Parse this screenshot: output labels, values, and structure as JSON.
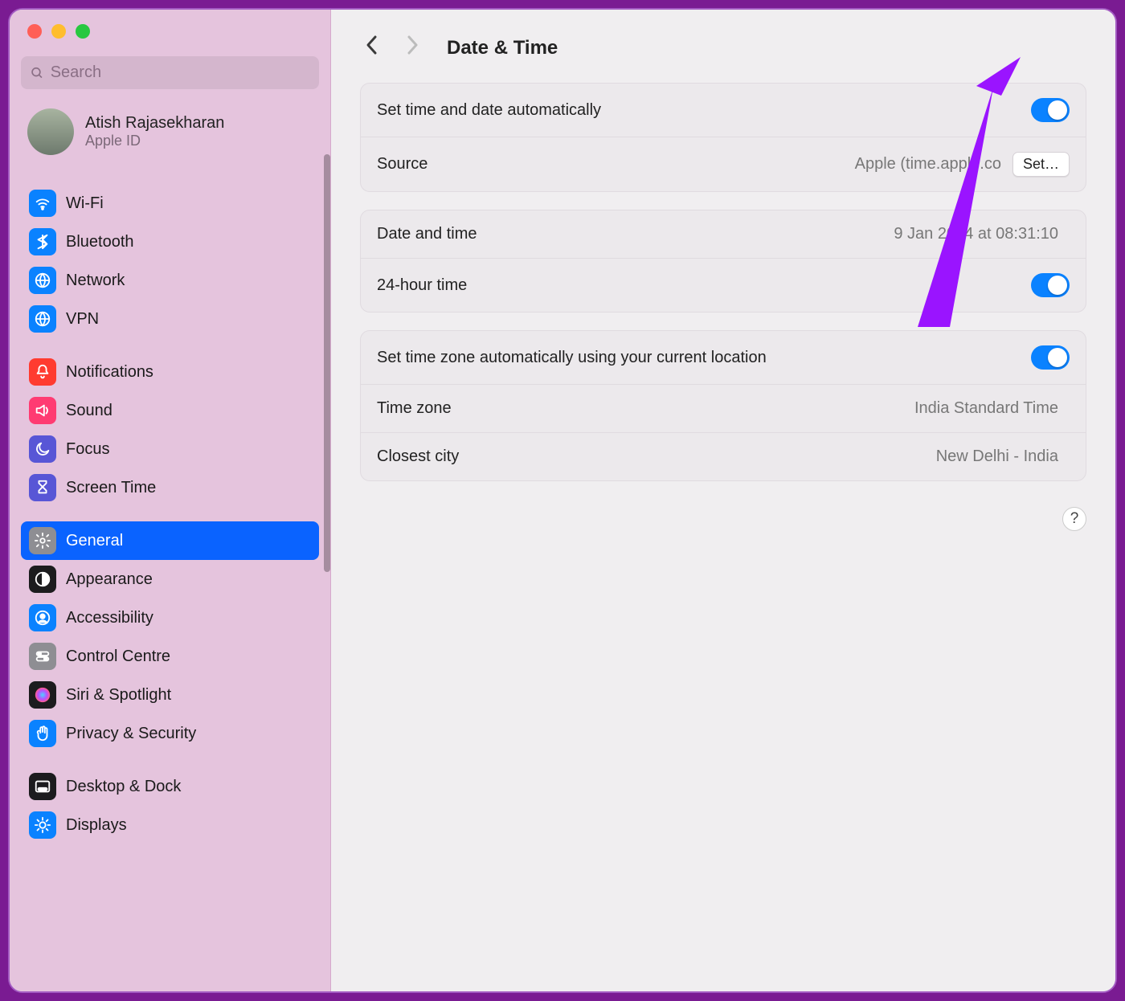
{
  "search": {
    "placeholder": "Search"
  },
  "account": {
    "name": "Atish Rajasekharan",
    "subtitle": "Apple ID"
  },
  "sidebar_groups": [
    [
      {
        "key": "wifi",
        "label": "Wi-Fi",
        "icon": "wifi",
        "bg": "#0a82ff"
      },
      {
        "key": "bluetooth",
        "label": "Bluetooth",
        "icon": "bluetooth",
        "bg": "#0a82ff"
      },
      {
        "key": "network",
        "label": "Network",
        "icon": "globe",
        "bg": "#0a82ff"
      },
      {
        "key": "vpn",
        "label": "VPN",
        "icon": "globe",
        "bg": "#0a82ff"
      }
    ],
    [
      {
        "key": "notifications",
        "label": "Notifications",
        "icon": "bell",
        "bg": "#ff3b30"
      },
      {
        "key": "sound",
        "label": "Sound",
        "icon": "speaker",
        "bg": "#ff3b72"
      },
      {
        "key": "focus",
        "label": "Focus",
        "icon": "moon",
        "bg": "#5856d6"
      },
      {
        "key": "screentime",
        "label": "Screen Time",
        "icon": "hourglass",
        "bg": "#5856d6"
      }
    ],
    [
      {
        "key": "general",
        "label": "General",
        "icon": "gear",
        "bg": "#8e8e93",
        "selected": true
      },
      {
        "key": "appearance",
        "label": "Appearance",
        "icon": "contrast",
        "bg": "#1c1c1e"
      },
      {
        "key": "accessibility",
        "label": "Accessibility",
        "icon": "person",
        "bg": "#0a82ff"
      },
      {
        "key": "controlcentre",
        "label": "Control Centre",
        "icon": "switches",
        "bg": "#8e8e93"
      },
      {
        "key": "siri",
        "label": "Siri & Spotlight",
        "icon": "siri",
        "bg": "#1c1c1e"
      },
      {
        "key": "privacy",
        "label": "Privacy & Security",
        "icon": "hand",
        "bg": "#0a82ff"
      }
    ],
    [
      {
        "key": "desktop",
        "label": "Desktop & Dock",
        "icon": "dock",
        "bg": "#1c1c1e"
      },
      {
        "key": "displays",
        "label": "Displays",
        "icon": "brightness",
        "bg": "#0a82ff"
      }
    ]
  ],
  "page": {
    "title": "Date & Time",
    "groups": [
      {
        "rows": [
          {
            "key": "auto_datetime",
            "label": "Set time and date automatically",
            "control": "toggle",
            "on": true
          },
          {
            "key": "source",
            "label": "Source",
            "value": "Apple (time.apple.co",
            "control": "button",
            "button_label": "Set…"
          }
        ]
      },
      {
        "rows": [
          {
            "key": "datetime",
            "label": "Date and time",
            "value": "9 Jan 2024 at 08:31:10"
          },
          {
            "key": "24hr",
            "label": "24-hour time",
            "control": "toggle",
            "on": true
          }
        ]
      },
      {
        "rows": [
          {
            "key": "auto_tz",
            "label": "Set time zone automatically using your current location",
            "control": "toggle",
            "on": true
          },
          {
            "key": "tz",
            "label": "Time zone",
            "value": "India Standard Time"
          },
          {
            "key": "city",
            "label": "Closest city",
            "value": "New Delhi - India"
          }
        ]
      }
    ]
  },
  "annotation_color": "#9a14ff"
}
